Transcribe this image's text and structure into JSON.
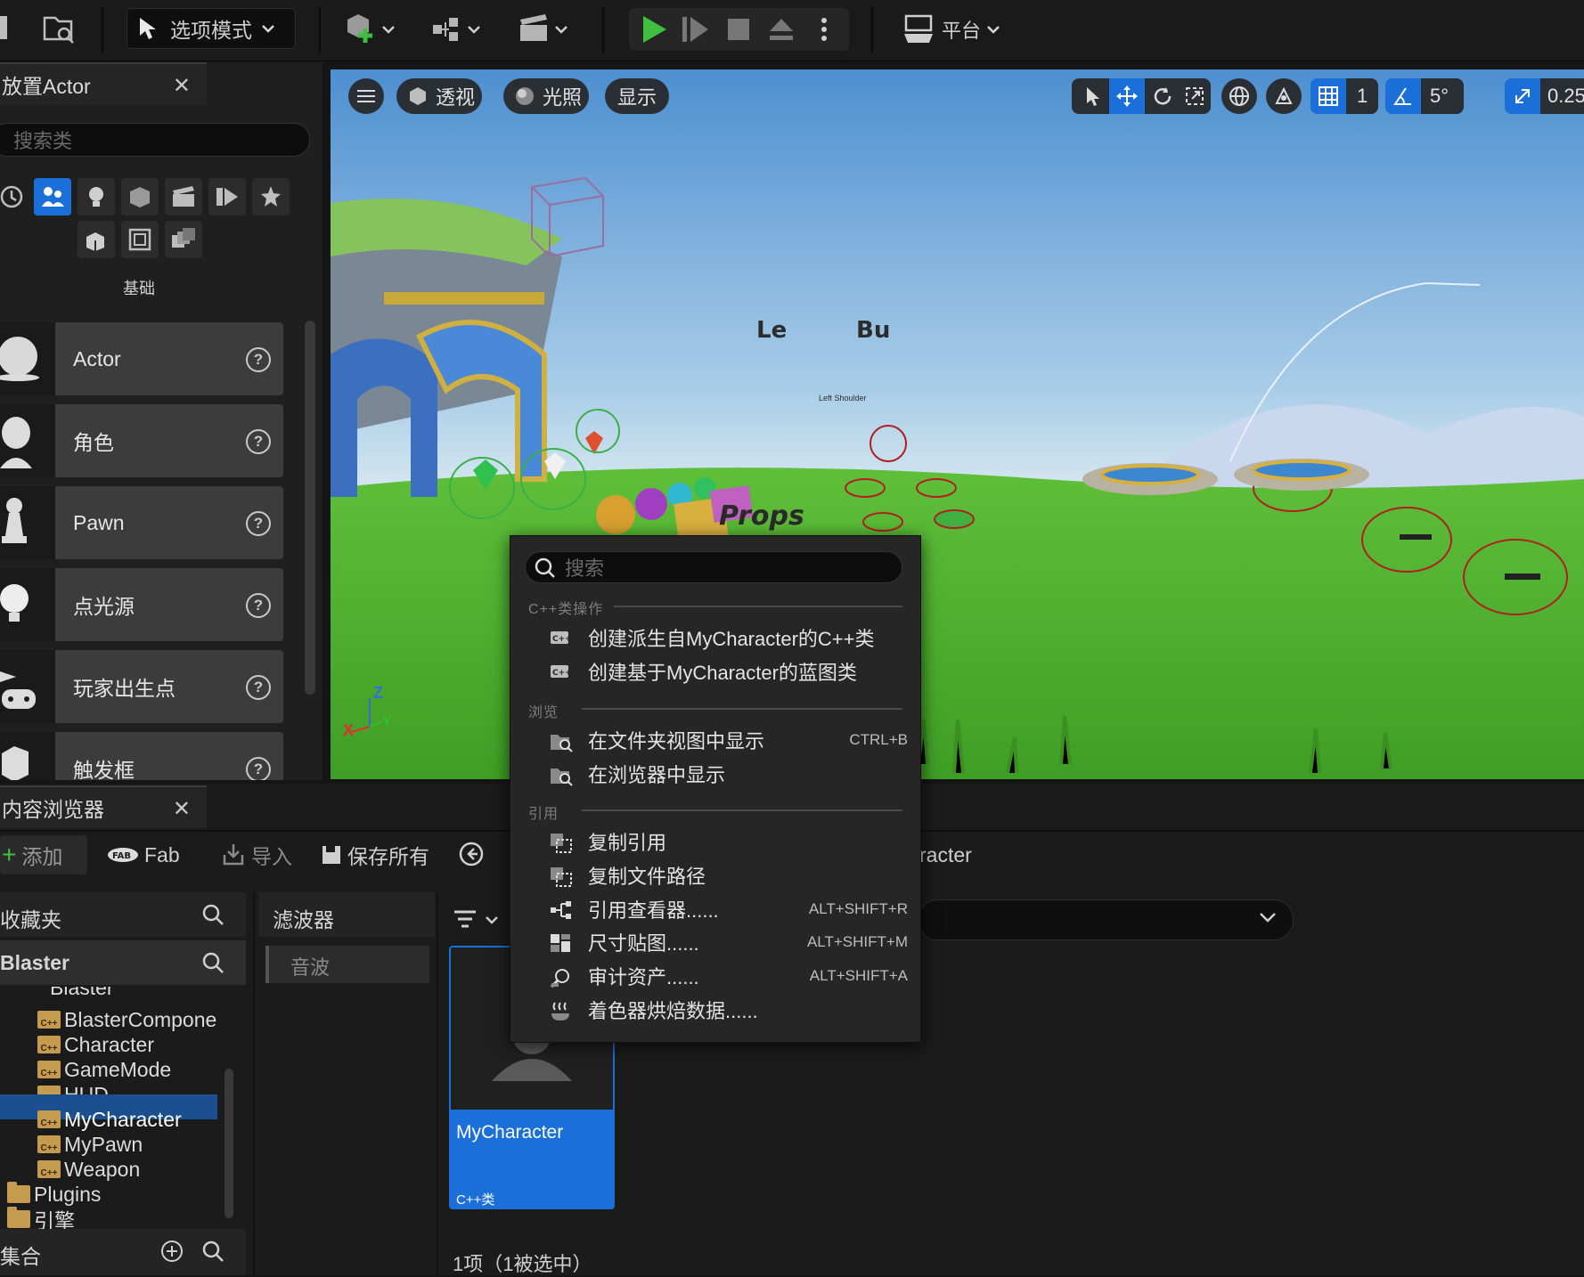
{
  "toolbar": {
    "mode_label": "选项模式",
    "platform_label": "平台"
  },
  "place_actor": {
    "title": "放置Actor",
    "search_placeholder": "搜索类",
    "category_label": "基础",
    "items": [
      {
        "label": "Actor"
      },
      {
        "label": "角色"
      },
      {
        "label": "Pawn"
      },
      {
        "label": "点光源"
      },
      {
        "label": "玩家出生点"
      },
      {
        "label": "触发框"
      }
    ]
  },
  "viewport": {
    "perspective": "透视",
    "lighting": "光照",
    "show": "显示",
    "grid_size": "1",
    "rotation_snap": "5°",
    "scale_snap": "0.25",
    "scene_text": {
      "left_label": "Le",
      "right_label": "Bu",
      "left_shoulder": "Left Shoulder",
      "props": "Props"
    },
    "axis": {
      "x": "X",
      "y": "Y",
      "z": "Z"
    }
  },
  "content_browser": {
    "title": "内容浏览器",
    "add": "添加",
    "fab": "Fab",
    "import": "导入",
    "save_all": "保存所有",
    "path_fragment": "racter",
    "favorites": "收藏夹",
    "root": "Blaster",
    "tree_partial": "Blaster",
    "tree": [
      "BlasterCompone",
      "Character",
      "GameMode",
      "HUD",
      "MyCharacter",
      "MyPawn",
      "Weapon"
    ],
    "plugins": "Plugins",
    "engine": "引擎",
    "collections": "集合",
    "filters": "滤波器",
    "filter_chip": "音波",
    "asset": {
      "name": "MyCharacter",
      "type": "C++类"
    },
    "status": "1项（1被选中）"
  },
  "context_menu": {
    "search_placeholder": "搜索",
    "sections": {
      "cpp": "C++类操作",
      "browse": "浏览",
      "reference": "引用"
    },
    "items": {
      "create_cpp": "创建派生自MyCharacter的C++类",
      "create_bp": "创建基于MyCharacter的蓝图类",
      "show_folder": "在文件夹视图中显示",
      "show_folder_key": "CTRL+B",
      "show_browser": "在浏览器中显示",
      "copy_ref": "复制引用",
      "copy_path": "复制文件路径",
      "ref_viewer": "引用查看器......",
      "ref_viewer_key": "ALT+SHIFT+R",
      "size_map": "尺寸贴图......",
      "size_map_key": "ALT+SHIFT+M",
      "audit": "审计资产......",
      "audit_key": "ALT+SHIFT+A",
      "shader": "着色器烘焙数据......"
    }
  },
  "colors": {
    "accent": "#1a6fd8",
    "play_green": "#3fbf3f",
    "panel": "#1f1f1f",
    "menu_bg": "#262626"
  }
}
